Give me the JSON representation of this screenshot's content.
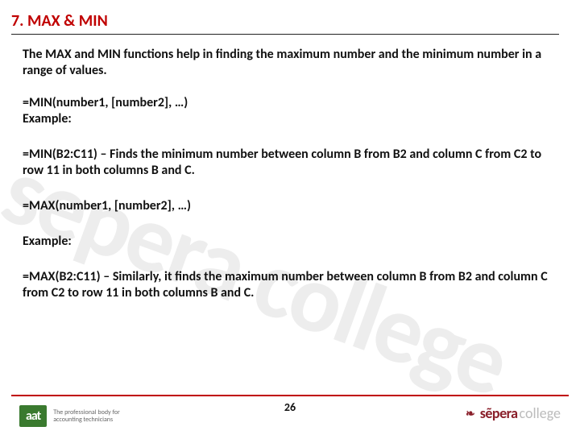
{
  "heading": "7. MAX & MIN",
  "intro": "The MAX and MIN functions help in finding the maximum number and the minimum number in a range of values.",
  "min_syntax": "=MIN(number1, [number2], …)",
  "example_label": "Example:",
  "min_example": "=MIN(B2:C11) – Finds the minimum number between column B from B2 and column C from C2 to row 11 in both columns B and C.",
  "max_syntax": "=MAX(number1, [number2], …)",
  "max_example": "=MAX(B2:C11) – Similarly, it finds the maximum number between column B from B2 and column C from C2 to row 11 in both columns B and C.",
  "page_number": "26",
  "watermark": "sepera college",
  "aat": {
    "logo": "aat",
    "tag1": "The professional body for",
    "tag2": "accounting technicians"
  },
  "sepera": {
    "brand": "sẽpera",
    "college": "college"
  }
}
